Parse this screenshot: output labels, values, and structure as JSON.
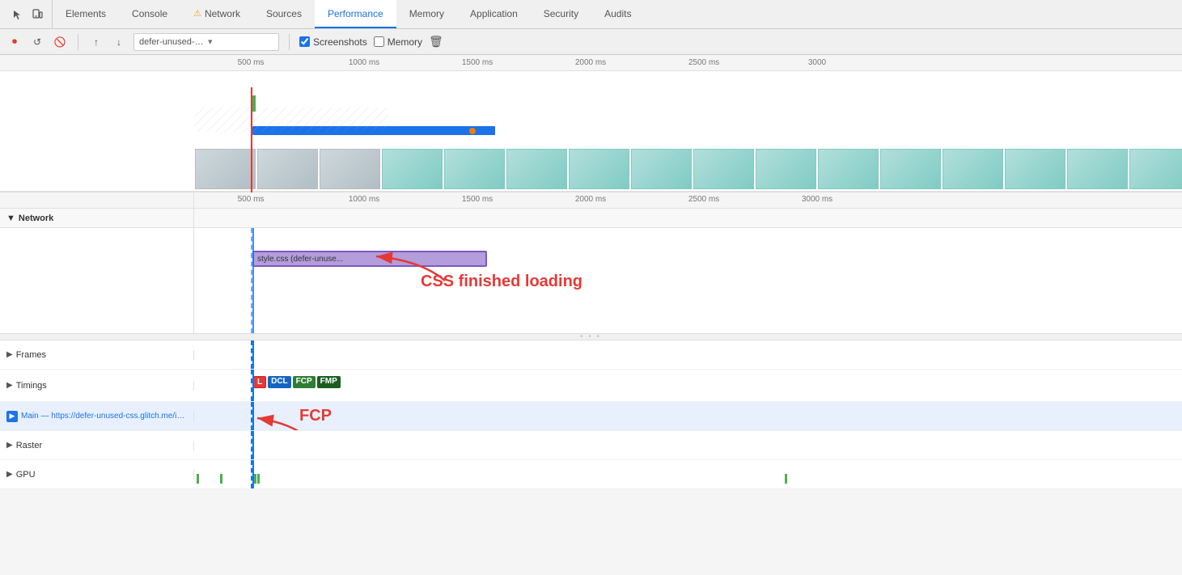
{
  "tabs": [
    {
      "id": "elements",
      "label": "Elements",
      "active": false,
      "icon": null
    },
    {
      "id": "console",
      "label": "Console",
      "active": false,
      "icon": null
    },
    {
      "id": "network",
      "label": "Network",
      "active": false,
      "icon": "warning"
    },
    {
      "id": "sources",
      "label": "Sources",
      "active": false,
      "icon": null
    },
    {
      "id": "performance",
      "label": "Performance",
      "active": true,
      "icon": null
    },
    {
      "id": "memory",
      "label": "Memory",
      "active": false,
      "icon": null
    },
    {
      "id": "application",
      "label": "Application",
      "active": false,
      "icon": null
    },
    {
      "id": "security",
      "label": "Security",
      "active": false,
      "icon": null
    },
    {
      "id": "audits",
      "label": "Audits",
      "active": false,
      "icon": null
    }
  ],
  "toolbar": {
    "url_text": "defer-unused-css.glitch....",
    "screenshots_label": "Screenshots",
    "memory_label": "Memory",
    "screenshots_checked": true,
    "memory_checked": false
  },
  "time_marks": [
    "500 ms",
    "1000 ms",
    "1500 ms",
    "2000 ms",
    "2500 ms",
    "3000 ms"
  ],
  "time_marks_2": [
    "500 ms",
    "1000 ms",
    "1500 ms",
    "2000 ms",
    "2500 ms",
    "3000 ms"
  ],
  "network_section": {
    "label": "Network",
    "css_bar_label": "style.css (defer-unuse...",
    "css_finished_label": "CSS finished loading"
  },
  "tracks": [
    {
      "id": "frames",
      "label": "Frames",
      "expanded": false
    },
    {
      "id": "timings",
      "label": "Timings",
      "expanded": false
    },
    {
      "id": "main",
      "label": "Main — https://defer-unused-css.glitch.me/index-optimized.html",
      "expanded": false,
      "selected": true
    },
    {
      "id": "raster",
      "label": "Raster",
      "expanded": false
    },
    {
      "id": "gpu",
      "label": "GPU",
      "expanded": false
    }
  ],
  "timings_badges": [
    "L",
    "DCL",
    "FCP",
    "FMP"
  ],
  "fcp_label": "FCP",
  "annotation": {
    "arrow_text": "→",
    "css_finished": "CSS finished loading",
    "fcp": "FCP"
  }
}
